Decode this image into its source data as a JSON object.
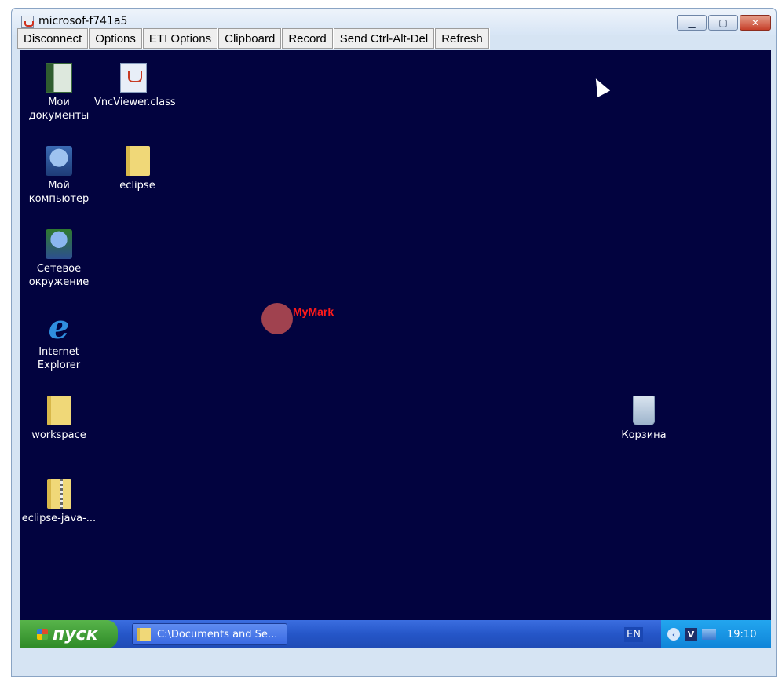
{
  "window": {
    "title": "microsof-f741a5"
  },
  "toolbar": {
    "buttons": [
      "Disconnect",
      "Options",
      "ETI Options",
      "Clipboard",
      "Record",
      "Send Ctrl-Alt-Del",
      "Refresh"
    ]
  },
  "desktop": {
    "background_color": "#02033f",
    "icons": {
      "my_documents": {
        "line1": "Мои",
        "line2": "документы"
      },
      "vncviewer": {
        "line1": "VncViewer.class"
      },
      "my_computer": {
        "line1": "Мой",
        "line2": "компьютер"
      },
      "eclipse": {
        "line1": "eclipse"
      },
      "network": {
        "line1": "Сетевое",
        "line2": "окружение"
      },
      "ie": {
        "line1": "Internet",
        "line2": "Explorer"
      },
      "workspace": {
        "line1": "workspace"
      },
      "eclipse_zip": {
        "line1": "eclipse-java-..."
      },
      "recycle": {
        "line1": "Корзина"
      }
    },
    "mark_label": "MyMark"
  },
  "taskbar": {
    "start_label": "пуск",
    "task_item": "C:\\Documents and Se...",
    "language": "EN",
    "clock": "19:10"
  }
}
